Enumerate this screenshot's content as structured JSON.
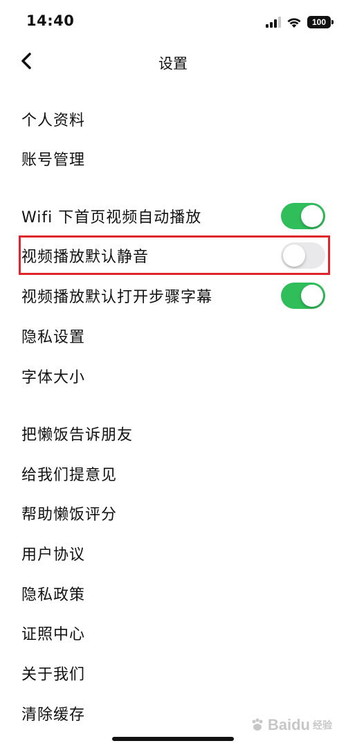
{
  "status_bar": {
    "time": "14:40",
    "battery": "100",
    "icons": [
      "signal-icon",
      "wifi-icon",
      "battery-icon"
    ]
  },
  "nav": {
    "title": "设置",
    "back_icon": "chevron-left-icon"
  },
  "groups": [
    {
      "items": [
        {
          "label": "个人资料"
        },
        {
          "label": "账号管理"
        }
      ]
    },
    {
      "items": [
        {
          "label": "Wifi 下首页视频自动播放",
          "toggle": true,
          "value": "on"
        },
        {
          "label": "视频播放默认静音",
          "toggle": true,
          "value": "off",
          "highlighted": true
        },
        {
          "label": "视频播放默认打开步骤字幕",
          "toggle": true,
          "value": "on"
        },
        {
          "label": "隐私设置"
        },
        {
          "label": "字体大小"
        }
      ]
    },
    {
      "items": [
        {
          "label": "把懒饭告诉朋友"
        },
        {
          "label": "给我们提意见"
        },
        {
          "label": "帮助懒饭评分"
        },
        {
          "label": "用户协议"
        },
        {
          "label": "隐私政策"
        },
        {
          "label": "证照中心"
        },
        {
          "label": "关于我们"
        },
        {
          "label": "清除缓存"
        }
      ]
    }
  ],
  "watermark": {
    "text": "Baidu",
    "sub": "经验"
  },
  "colors": {
    "toggle_on": "#2fbe5a",
    "toggle_off": "#e9e9eb",
    "highlight": "#e0242b"
  }
}
